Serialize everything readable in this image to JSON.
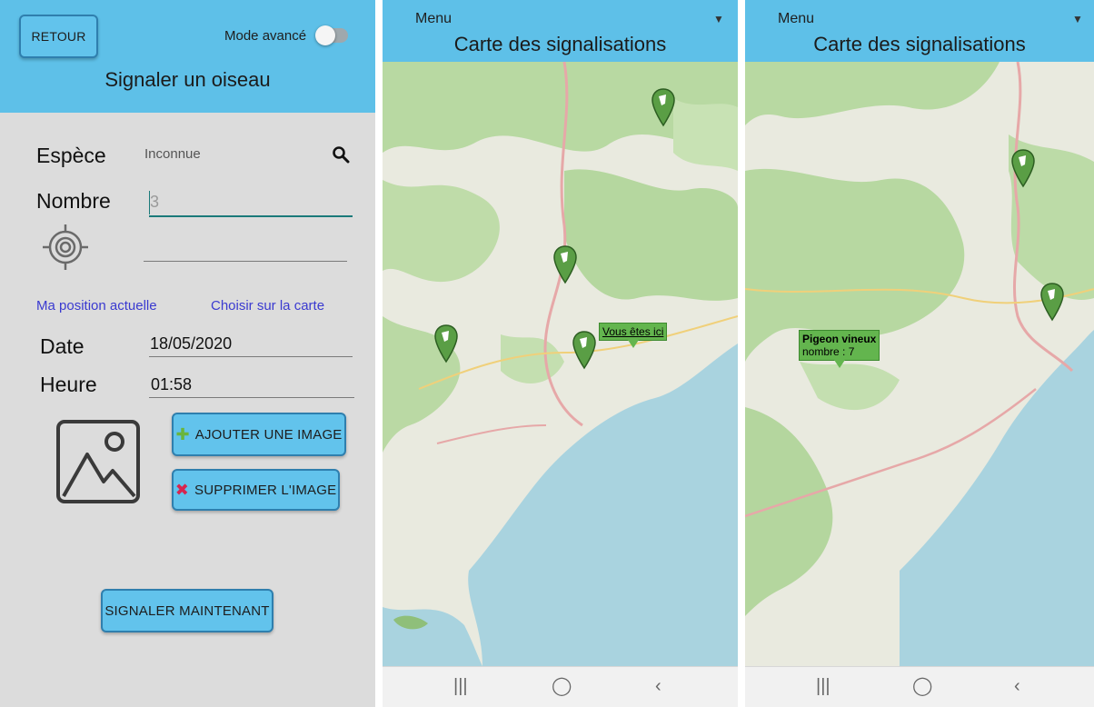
{
  "form": {
    "back_label": "RETOUR",
    "advanced_label": "Mode avancé",
    "title": "Signaler un oiseau",
    "species_label": "Espèce",
    "species_value": "Inconnue",
    "number_label": "Nombre",
    "number_value": "3",
    "position_current_link": "Ma position actuelle",
    "position_map_link": "Choisir sur la carte",
    "date_label": "Date",
    "date_value": "18/05/2020",
    "time_label": "Heure",
    "time_value": "01:58",
    "add_image_label": "AJOUTER UNE IMAGE",
    "remove_image_label": "SUPPRIMER L'IMAGE",
    "submit_label": "SIGNALER MAINTENANT"
  },
  "map1": {
    "menu_label": "Menu",
    "title": "Carte des signalisations",
    "callout": "Vous êtes ici"
  },
  "map2": {
    "menu_label": "Menu",
    "title": "Carte des signalisations",
    "callout_line1": "Pigeon vineux",
    "callout_line2": "nombre : 7"
  },
  "colors": {
    "header": "#5ec0e8",
    "button": "#62c3ec",
    "link": "#3a3ad0",
    "marker": "#5a9e45",
    "sea": "#a9d3df",
    "land": "#e9eadf",
    "forest": "#b6d8a0"
  },
  "icons": {
    "search": "search-icon",
    "gps": "gps-target-icon",
    "image": "image-placeholder-icon",
    "add": "plus-icon",
    "remove": "cross-icon",
    "marker": "map-marker-icon"
  }
}
